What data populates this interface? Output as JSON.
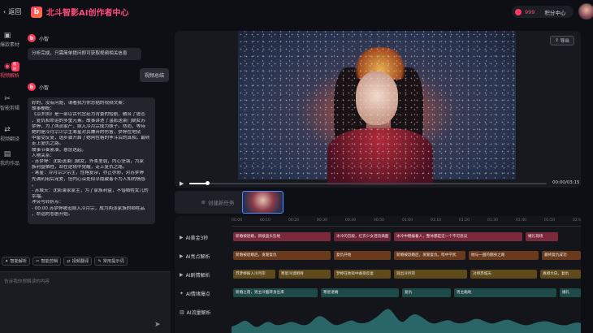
{
  "header": {
    "back_label": "返回",
    "app_title": "北斗智影AI创作者中心",
    "credits_value": "999",
    "credits_center_label": "积分中心"
  },
  "sidebar": {
    "items": [
      {
        "label": "爆款素材",
        "icon": "media-icon"
      },
      {
        "label": "视频解析",
        "icon": "analysis-icon",
        "badge": "限时",
        "active": true
      },
      {
        "label": "智能剪辑",
        "icon": "scissors-icon"
      },
      {
        "label": "视频翻译",
        "icon": "translate-icon"
      },
      {
        "label": "我的作品",
        "icon": "works-icon"
      }
    ]
  },
  "chat": {
    "bot_name": "小智",
    "messages": [
      {
        "role": "bot",
        "text": "分析完成，只需简单提问即可获取视频相关信息"
      },
      {
        "role": "user",
        "text": "视频总结"
      },
      {
        "role": "bot",
        "lines": [
          "好的，没有问题，请看我为你总结的视频文案：",
          " 故事梗概：",
          " 《凉岁拼》是一部以古代宫廷为背景的短剧，融合了虐恋",
          "，复仇和命运的多重元素。故事讲述了温影送萧门嫡女苏",
          "梦婷，为了两派家产，嫁入冷月宗成为妹子。然而，等待",
          "她的是冷月宗少宗主寒星对其嫌弃的伤害，梦婷在地狱",
          "中备受反复，逃步骤开启了她两性格的争斗后的真相，最终",
          "走上复仇之路。",
          " 故事节奏紧凑，悬念迭起。",
          " 人物关系：",
          " - 苏梦婷：沈影送萧门嫡女，外柔里弱，内心坚强，为家",
          "族利益牺牲，却在逆境中觉醒，走上复仇之路。",
          " - 寒星：冷月宗少宗主，性格复杂，亦正亦邪，对苏梦婷",
          "先满利用后宠爱，但内心深处似乎隐藏着不为人知的情感",
          "。",
          " - 苏城天：沈影萧家家主，为了家族利益，不惜牺牲女儿的",
          "幸福。",
          " 冲突与转折点：",
          " - 00:00 苏梦婷被迫嫁入冷月宗，成为两派家族的牺牲品",
          "，命运的悲剧开始。"
        ]
      }
    ],
    "quick_actions": [
      "智能解析",
      "智能剪辑",
      "视频翻译",
      "常用提示词"
    ],
    "input_placeholder": "告诉我你想解读的内容"
  },
  "player": {
    "export_label": "导出",
    "time_display": "00:00/03:15",
    "progress": 0.05
  },
  "task": {
    "create_label": "创建新任务"
  },
  "timeline": {
    "ticks": [
      "00:00",
      "00:10",
      "00:20",
      "00:30",
      "00:40",
      "00:50",
      "01:00",
      "01:10",
      "01:20",
      "01:30",
      "01:40",
      "01:50",
      "02:00"
    ],
    "tracks": [
      {
        "label": "AI黄金3秒",
        "icon": "play-icon",
        "clips": [
          {
            "text": "新婚被退婚，新娘盖头坠地",
            "c": "c-red",
            "l": 72,
            "w": 120
          },
          {
            "text": "冰冷的宫殿，红衣少女泪流满面",
            "c": "c-dred",
            "l": 196,
            "w": 70
          },
          {
            "text": "冰冷中瞪编着人，整体都是这一个不可思议",
            "c": "c-red",
            "l": 270,
            "w": 158
          },
          {
            "text": "婚礼现场",
            "c": "c-red",
            "l": 432,
            "w": 40
          }
        ]
      },
      {
        "label": "AI亮点解析",
        "icon": "play-icon",
        "clips": [
          {
            "text": "新婚被退婚后，发誓复仇",
            "c": "c-orange",
            "l": 72,
            "w": 120
          },
          {
            "text": "复仇开始",
            "c": "c-orange",
            "l": 196,
            "w": 70
          },
          {
            "text": "新婚被退婚后，发誓复仇，暗中学武",
            "c": "c-orange",
            "l": 270,
            "w": 88
          },
          {
            "text": "她与一国的翻身之路",
            "c": "c-orange",
            "l": 362,
            "w": 86
          },
          {
            "text": "最终复仇成功",
            "c": "c-orange",
            "l": 452,
            "w": 48
          }
        ]
      },
      {
        "label": "AI剧情解析",
        "icon": "play-icon",
        "clips": [
          {
            "text": "苏梦婷嫁入冷月宗",
            "c": "c-gold",
            "l": 72,
            "w": 52
          },
          {
            "text": "寒星冷漠相待",
            "c": "c-gold",
            "l": 128,
            "w": 64
          },
          {
            "text": "梦婷在地狱中备受反复",
            "c": "c-gold",
            "l": 196,
            "w": 70
          },
          {
            "text": "逃出冷月宗",
            "c": "c-gold",
            "l": 270,
            "w": 90
          },
          {
            "text": "对峙苏城天",
            "c": "c-gold",
            "l": 364,
            "w": 82
          },
          {
            "text": "真相大白，复仇",
            "c": "c-gold",
            "l": 450,
            "w": 50
          }
        ]
      },
      {
        "label": "AI情绪爆点",
        "icon": "bulb-icon",
        "clips": [
          {
            "text": "新婚之夜，男主冷酷转身出来",
            "c": "c-teal",
            "l": 72,
            "w": 104
          },
          {
            "text": "寒星退婚",
            "c": "c-teal",
            "l": 180,
            "w": 96
          },
          {
            "text": "复仇",
            "c": "c-teal",
            "l": 280,
            "w": 60
          },
          {
            "text": "男主跪地",
            "c": "c-teal",
            "l": 344,
            "w": 126
          },
          {
            "text": "婚礼",
            "c": "c-teal",
            "l": 474,
            "w": 26
          }
        ]
      },
      {
        "label": "AI流量解析",
        "icon": "chart-icon",
        "clips": []
      }
    ]
  }
}
